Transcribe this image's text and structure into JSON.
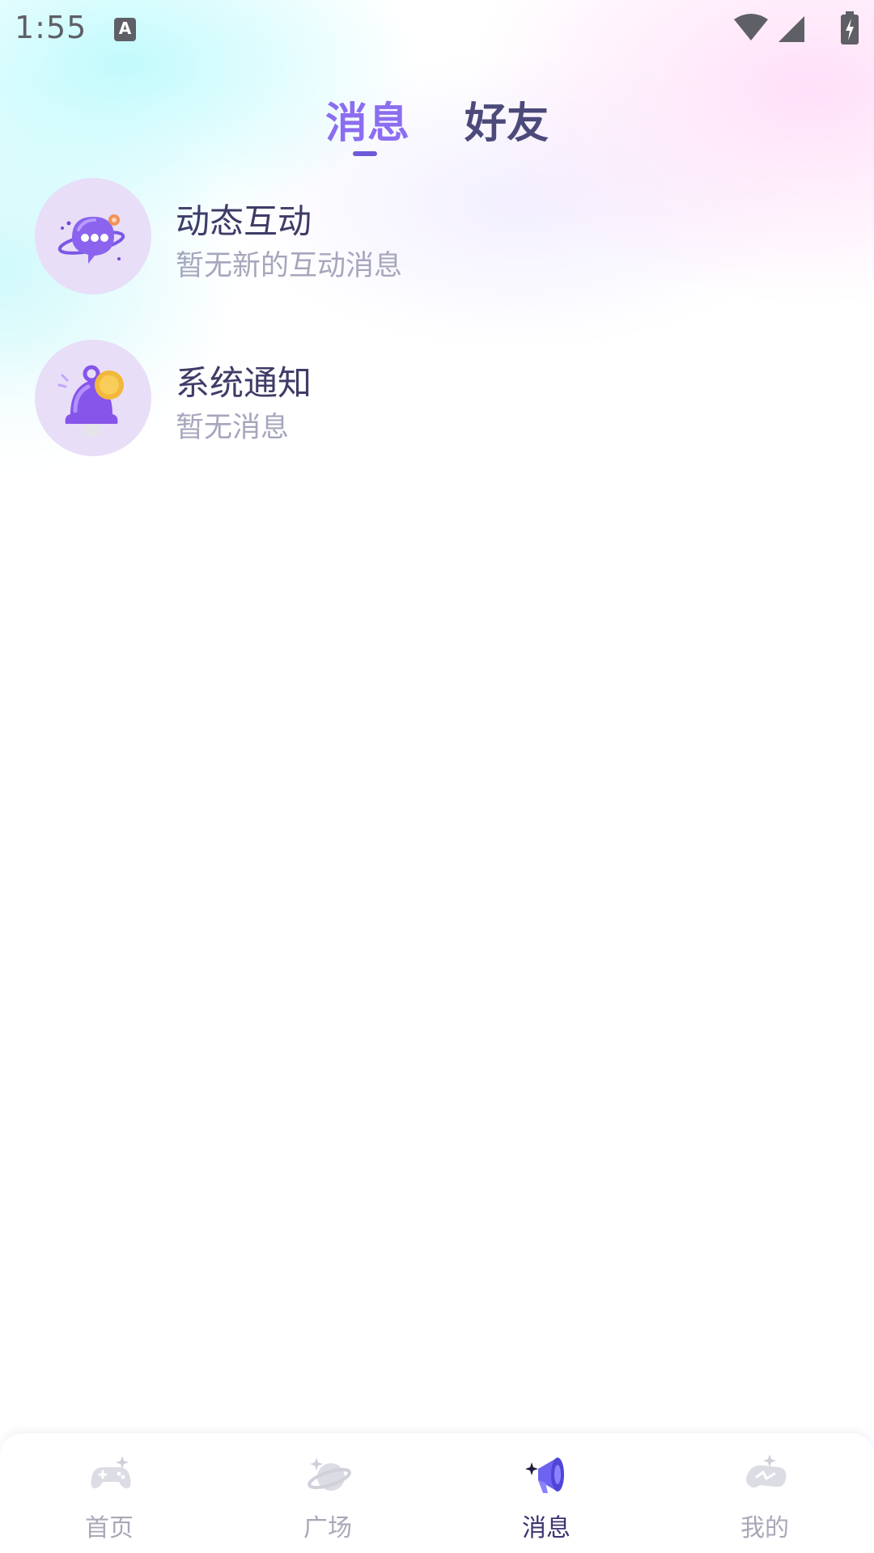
{
  "status_bar": {
    "time": "1:55",
    "icons": [
      "keyboard-a-icon",
      "wifi-icon",
      "signal-icon",
      "battery-charging-icon"
    ]
  },
  "top_tabs": {
    "active": "消息",
    "items": [
      {
        "label": "消息"
      },
      {
        "label": "好友"
      }
    ]
  },
  "messages": [
    {
      "title": "动态互动",
      "subtitle": "暂无新的互动消息",
      "icon": "chat-bubble-planet-icon"
    },
    {
      "title": "系统通知",
      "subtitle": "暂无消息",
      "icon": "notification-bell-icon"
    }
  ],
  "bottom_nav": {
    "active": "消息",
    "items": [
      {
        "label": "首页",
        "icon": "gamepad-icon"
      },
      {
        "label": "广场",
        "icon": "planet-icon"
      },
      {
        "label": "消息",
        "icon": "megaphone-icon"
      },
      {
        "label": "我的",
        "icon": "game-profile-icon"
      }
    ]
  },
  "colors": {
    "accent": "#8c6df0",
    "tab_inactive": "#4c4a7a",
    "title_text": "#3e3c68",
    "subtitle_text": "#a6a6bd",
    "nav_inactive": "#a8a8b8",
    "nav_active": "#3a3470"
  }
}
